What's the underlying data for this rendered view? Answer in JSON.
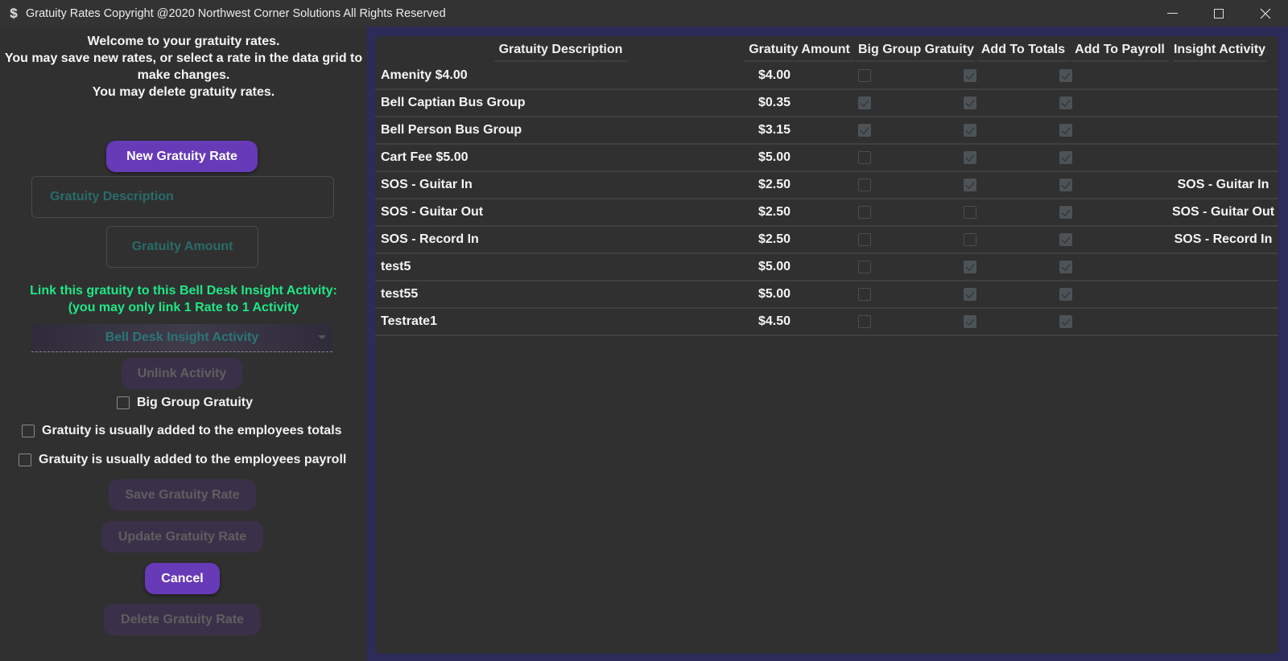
{
  "window": {
    "icon": "dollar-icon",
    "title": "Gratuity Rates Copyright @2020 Northwest Corner Solutions All Rights Reserved",
    "controls": [
      "minimize",
      "maximize",
      "close"
    ]
  },
  "form": {
    "welcome_lines": [
      "Welcome to your gratuity rates.",
      "You may save new rates, or select a rate in the data grid to",
      "make changes.",
      "You may delete gratuity rates."
    ],
    "new_button": "New Gratuity Rate",
    "description_placeholder": "Gratuity Description",
    "amount_placeholder": "Gratuity Amount",
    "link_label_lines": [
      "Link this gratuity to this Bell Desk Insight Activity:",
      "(you may only link 1 Rate to 1 Activity"
    ],
    "activity_combo_placeholder": "Bell Desk Insight Activity",
    "unlink_button": "Unlink Activity",
    "big_group_label": "Big Group Gratuity",
    "big_group_checked": false,
    "totals_label": "Gratuity is usually added to the employees totals",
    "totals_checked": false,
    "payroll_label": "Gratuity is usually added to the employees payroll",
    "payroll_checked": false,
    "save_button": "Save Gratuity Rate",
    "update_button": "Update Gratuity Rate",
    "cancel_button": "Cancel",
    "delete_button": "Delete Gratuity Rate"
  },
  "colors": {
    "accent": "#673ab7",
    "link_label": "#1ee886",
    "grid_frame": "#2d2b5a",
    "placeholder": "#2a6b6b"
  },
  "grid": {
    "columns": [
      "Gratuity Description",
      "Gratuity Amount",
      "Big Group Gratuity",
      "Add To Totals",
      "Add To Payroll",
      "Insight Activity"
    ],
    "rows": [
      {
        "description": "Amenity $4.00",
        "amount": "$4.00",
        "big_group": false,
        "add_totals": true,
        "add_payroll": true,
        "insight": ""
      },
      {
        "description": "Bell Captian Bus Group",
        "amount": "$0.35",
        "big_group": true,
        "add_totals": true,
        "add_payroll": true,
        "insight": ""
      },
      {
        "description": "Bell Person Bus Group",
        "amount": "$3.15",
        "big_group": true,
        "add_totals": true,
        "add_payroll": true,
        "insight": ""
      },
      {
        "description": "Cart Fee $5.00",
        "amount": "$5.00",
        "big_group": false,
        "add_totals": true,
        "add_payroll": true,
        "insight": ""
      },
      {
        "description": "SOS - Guitar In",
        "amount": "$2.50",
        "big_group": false,
        "add_totals": true,
        "add_payroll": true,
        "insight": "SOS - Guitar In"
      },
      {
        "description": "SOS - Guitar Out",
        "amount": "$2.50",
        "big_group": false,
        "add_totals": false,
        "add_payroll": true,
        "insight": "SOS - Guitar Out"
      },
      {
        "description": "SOS - Record In",
        "amount": "$2.50",
        "big_group": false,
        "add_totals": false,
        "add_payroll": true,
        "insight": "SOS - Record In"
      },
      {
        "description": "test5",
        "amount": "$5.00",
        "big_group": false,
        "add_totals": true,
        "add_payroll": true,
        "insight": ""
      },
      {
        "description": "test55",
        "amount": "$5.00",
        "big_group": false,
        "add_totals": true,
        "add_payroll": true,
        "insight": ""
      },
      {
        "description": "Testrate1",
        "amount": "$4.50",
        "big_group": false,
        "add_totals": true,
        "add_payroll": true,
        "insight": ""
      }
    ]
  }
}
